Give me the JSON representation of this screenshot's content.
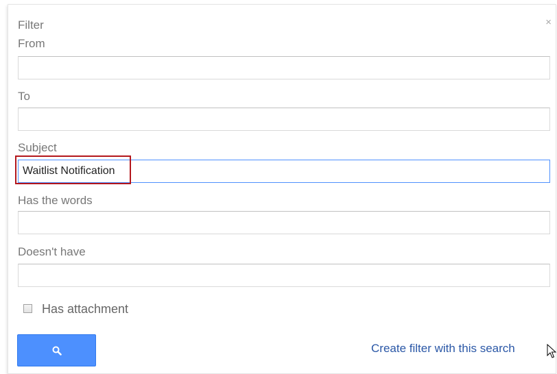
{
  "dialog": {
    "title": "Filter",
    "close_glyph": "×"
  },
  "fields": {
    "from": {
      "label": "From",
      "value": ""
    },
    "to": {
      "label": "To",
      "value": ""
    },
    "subject": {
      "label": "Subject",
      "value": "Waitlist Notification"
    },
    "has_words": {
      "label": "Has the words",
      "value": ""
    },
    "doesnt_have": {
      "label": "Doesn't have",
      "value": ""
    }
  },
  "attachment": {
    "label": "Has attachment",
    "checked": false
  },
  "actions": {
    "search_icon": "search-icon",
    "create_filter_label": "Create filter with this search"
  },
  "colors": {
    "accent": "#4d90fe",
    "link": "#2a57a6",
    "highlight": "#b3161b"
  }
}
